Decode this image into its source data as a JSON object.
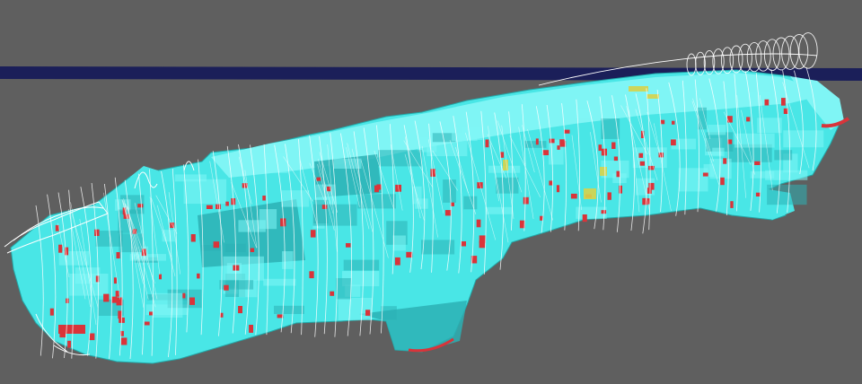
{
  "viewport": {
    "background": "#5f5f5f"
  },
  "palette": {
    "hull": "#49e6e6",
    "hull_light": "#7ff5f5",
    "hull_dark": "#23a8a8",
    "panel": "#2bb0b4",
    "wireframe": "#ffffff",
    "red_marks": "#d9343a",
    "yellow_marks": "#d7d34a",
    "horizon_band": "#1b1f59"
  }
}
